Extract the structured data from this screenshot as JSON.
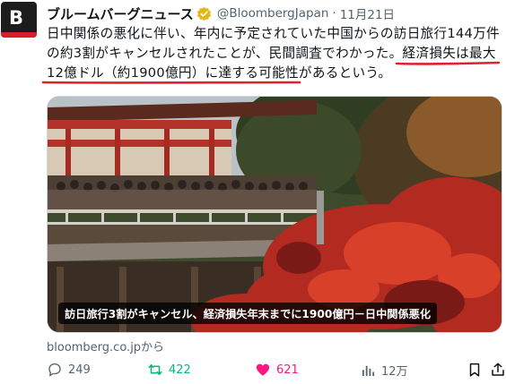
{
  "post": {
    "avatar_letter": "B",
    "display_name": "ブルームバーグニュース",
    "handle": "@BloombergJapan",
    "separator": "·",
    "date": "11月21日",
    "text": {
      "line1": "日中関係の悪化に伴い、年内に予定されていた中国からの訪日旅行144万件",
      "line2_plain": "の約3割がキャンセルされたことが、民間調査でわかった。",
      "line2_underlined": "経済損失は最大",
      "line3_underlined": "12億ドル（約1900億円）に達する可能性",
      "line3_plain": "があるという。"
    },
    "media_caption": "訪日旅行3割がキャンセル、経済損失年末までに1900億円－日中関係悪化",
    "link_source": "bloomberg.co.jpから"
  },
  "actions": {
    "reply_count": "249",
    "repost_count": "422",
    "like_count": "621",
    "view_count": "12万"
  },
  "colors": {
    "underline": "#e0202a",
    "repost": "#00ba7c",
    "like": "#f91880",
    "verified": "#e2b719"
  }
}
